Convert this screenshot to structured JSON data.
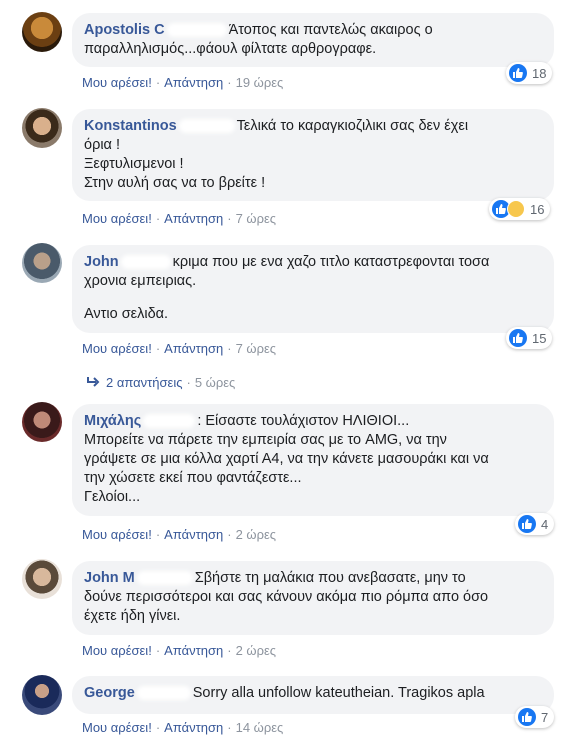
{
  "comments": [
    {
      "name": "Apostolis C",
      "lines": [
        "Άτοπος και παντελώς ακαιρος ο",
        "παραλληλισμός...φάουλ φίλτατε αρθρογραφε."
      ],
      "like": "Μου αρέσει!",
      "reply": "Απάντηση",
      "time": "19 ώρες",
      "reactions": "18"
    },
    {
      "name": "Konstantinos",
      "lines": [
        "Τελικά το καραγκιοζιλικι σας δεν έχει",
        "όρια !",
        "Ξεφτυλισμενοι !",
        "Στην αυλή σας να το βρείτε !"
      ],
      "like": "Μου αρέσει!",
      "reply": "Απάντηση",
      "time": "7 ώρες",
      "reactions": "16"
    },
    {
      "name": "John",
      "lines": [
        "κριμα που με ενα χαζο τιτλο καταστρεφονται τοσα",
        "χρονια εμπειριας.",
        "",
        "Αντιο σελιδα."
      ],
      "like": "Μου αρέσει!",
      "reply": "Απάντηση",
      "time": "7 ώρες",
      "reactions": "15",
      "replies": {
        "label": "2 απαντήσεις",
        "time": "5 ώρες"
      }
    },
    {
      "name": "Μιχάλης",
      "lines": [
        ": Είσαστε τουλάχιστον ΗΛΙΘΙΟΙ...",
        "Μπορείτε να πάρετε την εμπειρία σας με το AMG, να την",
        "γράψετε σε μια κόλλα χαρτί Α4, να την κάνετε μασουράκι και να",
        "την χώσετε εκεί που φαντάζεστε...",
        "Γελοίοι..."
      ],
      "like": "Μου αρέσει!",
      "reply": "Απάντηση",
      "time": "2 ώρες",
      "reactions": "4"
    },
    {
      "name": "John M",
      "lines": [
        "Σβήστε τη μαλάκια που ανεβασατε, μην το",
        "δούνε περισσότεροι και σας κάνουν ακόμα πιο ρόμπα απο όσο",
        "έχετε ήδη γίνει."
      ],
      "like": "Μου αρέσει!",
      "reply": "Απάντηση",
      "time": "2 ώρες",
      "reactions": ""
    },
    {
      "name": "George",
      "lines": [
        "Sorry alla unfollow kateutheian. Tragikos apla"
      ],
      "like": "Μου αρέσει!",
      "reply": "Απάντηση",
      "time": "14 ώρες",
      "reactions": "7"
    }
  ],
  "dot_separator": "·",
  "colors": {
    "link": "#385898",
    "bubble": "#f2f3f5",
    "like_blue": "#1877f2",
    "meta_gray": "#8d949e"
  }
}
